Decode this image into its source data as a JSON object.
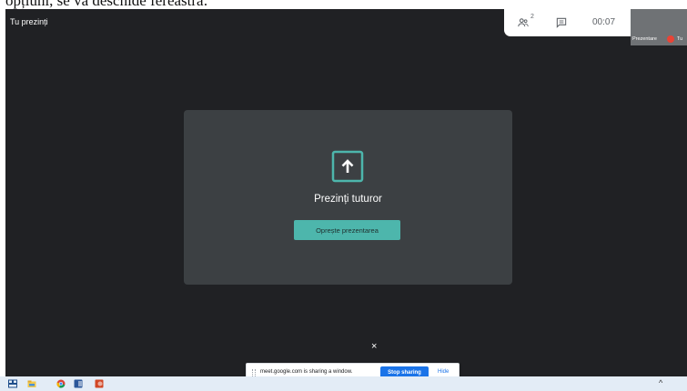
{
  "document": {
    "visible_text": "opțiuni, se va deschide fereastra:"
  },
  "meet": {
    "presenter_title": "Tu prezinți",
    "top_bar": {
      "people_count": "2",
      "time": "00:07"
    },
    "self_view": {
      "label": "Prezentare",
      "you": "Tu"
    },
    "card": {
      "heading": "Prezinți tuturor",
      "stop_button": "Oprește prezentarea"
    },
    "share_panel": {
      "close_glyph": "×"
    }
  },
  "sharing_banner": {
    "message": "meet.google.com is sharing a window.",
    "stop_button": "Stop sharing",
    "hide_button": "Hide"
  },
  "taskbar": {
    "overflow_glyph": "^"
  },
  "colors": {
    "stage_bg": "#202124",
    "card_bg": "#3c4043",
    "accent_teal": "#4db6ac",
    "google_blue": "#1a73e8",
    "mic_off_red": "#ea4335"
  }
}
